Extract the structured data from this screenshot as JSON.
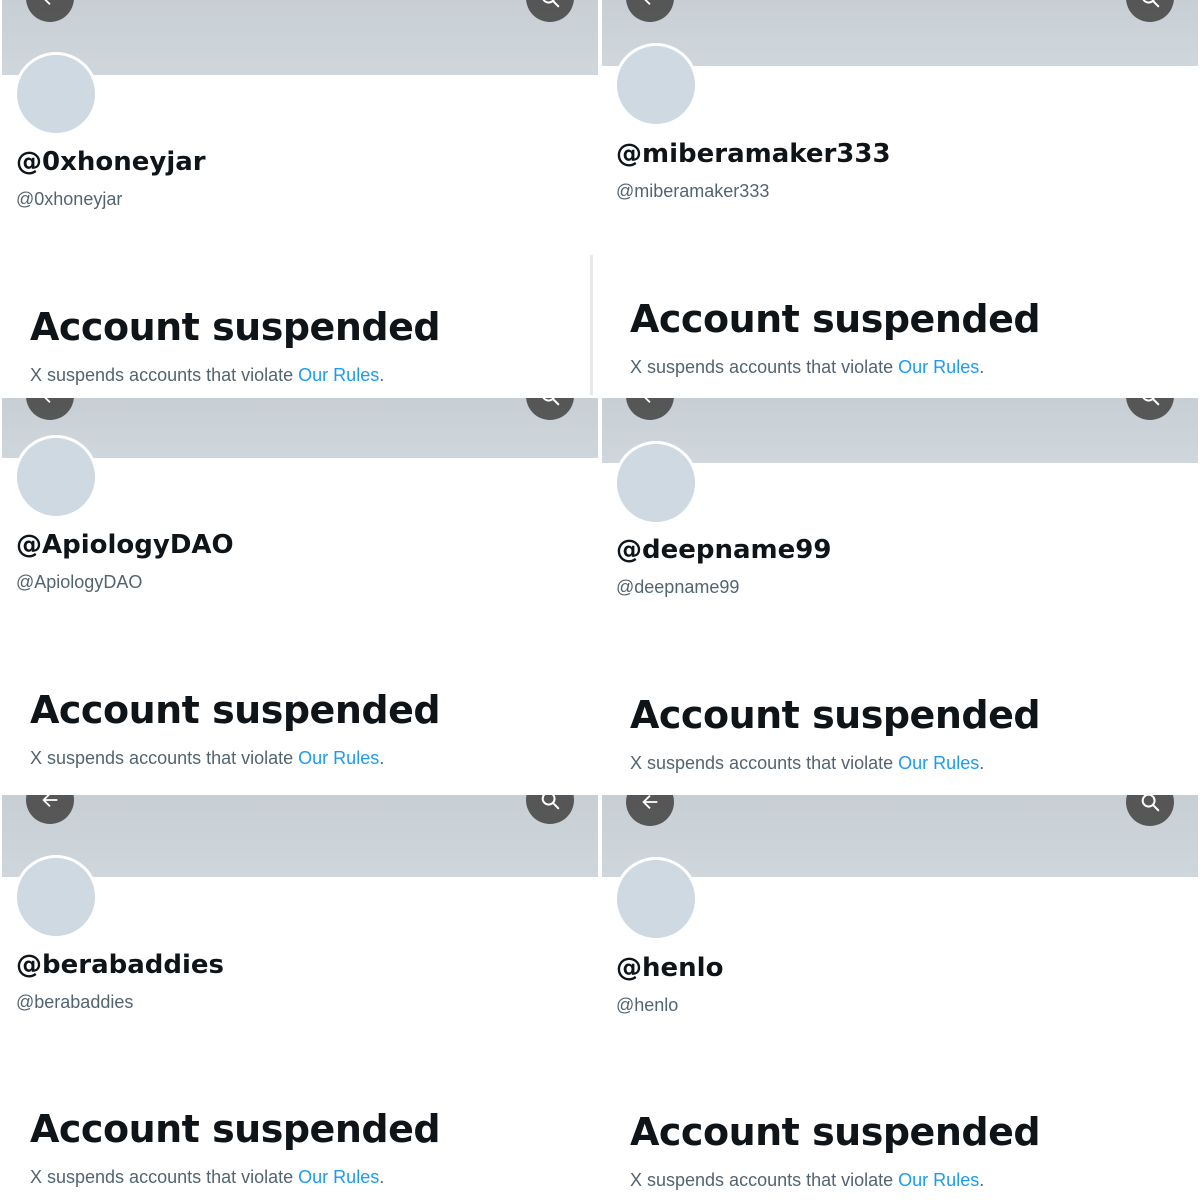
{
  "theme": {
    "banner_color": "#cfd7dd",
    "avatar_color": "#cfd9e1",
    "name_color": "#0f1419",
    "secondary_text_color": "#536471",
    "link_color": "#1d9bf0"
  },
  "icons": {
    "back": "arrow-left-icon",
    "search": "search-icon"
  },
  "profiles": [
    {
      "display_name": "@0xhoneyjar",
      "handle": "@0xhoneyjar",
      "status_title": "Account suspended",
      "status_text": "X suspends accounts that violate ",
      "rules_link": "Our Rules",
      "trailing": "."
    },
    {
      "display_name": "@miberamaker333",
      "handle": "@miberamaker333",
      "status_title": "Account suspended",
      "status_text": "X suspends accounts that violate ",
      "rules_link": "Our Rules",
      "trailing": "."
    },
    {
      "display_name": "@ApiologyDAO",
      "handle": "@ApiologyDAO",
      "status_title": "Account suspended",
      "status_text": "X suspends accounts that violate ",
      "rules_link": "Our Rules",
      "trailing": "."
    },
    {
      "display_name": "@deepname99",
      "handle": "@deepname99",
      "status_title": "Account suspended",
      "status_text": "X suspends accounts that violate ",
      "rules_link": "Our Rules",
      "trailing": "."
    },
    {
      "display_name": "@berabaddies",
      "handle": "@berabaddies",
      "status_title": "Account suspended",
      "status_text": "X suspends accounts that violate ",
      "rules_link": "Our Rules",
      "trailing": "."
    },
    {
      "display_name": "@henlo",
      "handle": "@henlo",
      "status_title": "Account suspended",
      "status_text": "X suspends accounts that violate ",
      "rules_link": "Our Rules",
      "trailing": "."
    }
  ]
}
